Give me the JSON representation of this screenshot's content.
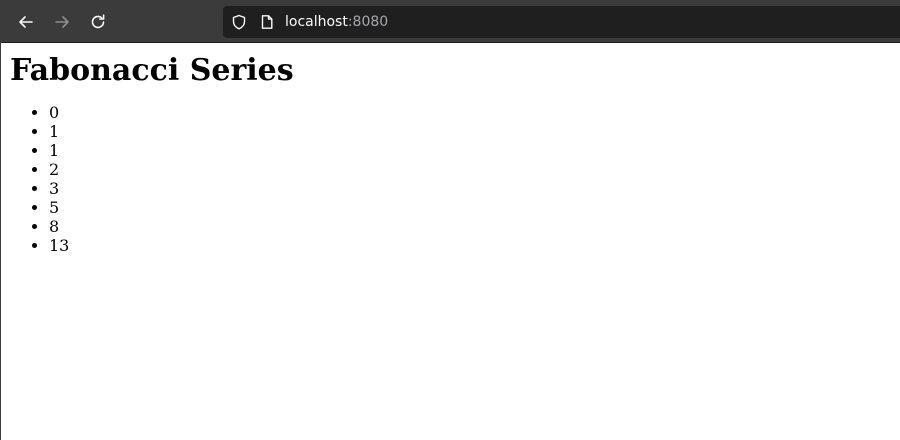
{
  "browser": {
    "url_host": "localhost",
    "url_port": ":8080",
    "back_enabled": true,
    "forward_enabled": false,
    "colors": {
      "toolbar": "#3b3b3b",
      "urlbar": "#1f1f1f",
      "url_text": "#fbfbfe",
      "url_port": "#a8a8ad",
      "icon_active": "#fbfbfe",
      "icon_disabled": "#8f8f95"
    },
    "icons": [
      "back-arrow-icon",
      "forward-arrow-icon",
      "reload-icon",
      "shield-icon",
      "page-icon"
    ]
  },
  "page": {
    "title": "Fabonacci Series",
    "items": [
      "0",
      "1",
      "1",
      "2",
      "3",
      "5",
      "8",
      "13"
    ]
  }
}
